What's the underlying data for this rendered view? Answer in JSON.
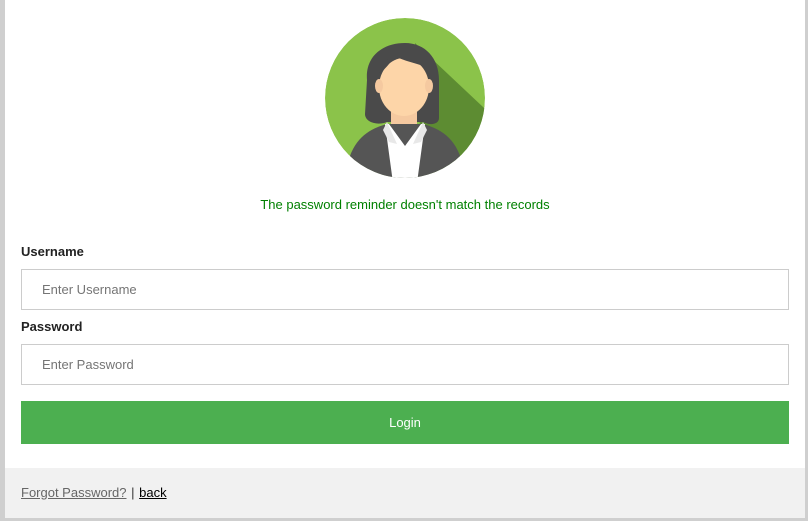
{
  "avatar": {
    "icon": "female-user-avatar-icon",
    "background_color": "#8bc34a"
  },
  "message": {
    "text": "The password reminder doesn't match the records",
    "color": "#008000"
  },
  "form": {
    "username_label": "Username",
    "username_placeholder": "Enter Username",
    "username_value": "",
    "password_label": "Password",
    "password_placeholder": "Enter Password",
    "password_value": "",
    "login_label": "Login",
    "login_color": "#4caf50"
  },
  "footer": {
    "forgot_label": "Forgot Password?",
    "separator": "|",
    "back_label": "back"
  }
}
